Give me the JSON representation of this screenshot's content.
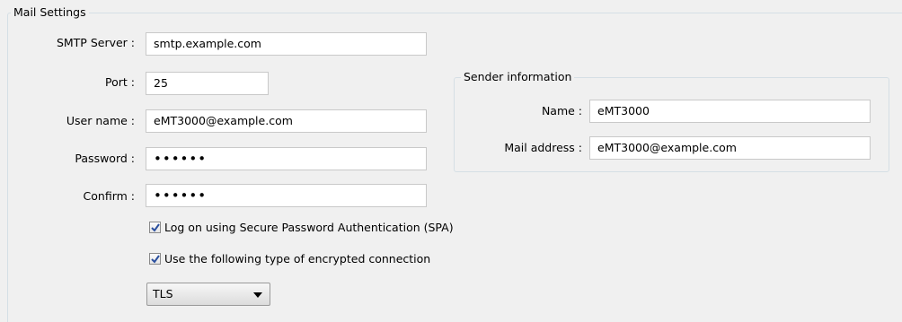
{
  "mail_settings": {
    "title": "Mail Settings",
    "smtp_server": {
      "label": "SMTP Server :",
      "value": "smtp.example.com"
    },
    "port": {
      "label": "Port :",
      "value": "25"
    },
    "user_name": {
      "label": "User name :",
      "value": "eMT3000@example.com"
    },
    "password": {
      "label": "Password :",
      "value": "••••••"
    },
    "confirm": {
      "label": "Confirm :",
      "value": "••••••"
    },
    "spa_checkbox": {
      "label": "Log on using Secure Password Authentication (SPA)",
      "checked": true
    },
    "encrypted_checkbox": {
      "label": "Use the following type of encrypted connection",
      "checked": true
    },
    "encryption_type": {
      "selected": "TLS",
      "icon": "chevron-down-icon"
    }
  },
  "sender_information": {
    "title": "Sender information",
    "name": {
      "label": "Name :",
      "value": "eMT3000"
    },
    "mail_address": {
      "label": "Mail address :",
      "value": "eMT3000@example.com"
    }
  },
  "colors": {
    "background": "#f0f0f0",
    "group_border": "#d5dfe5",
    "checkmark": "#2a4f9e"
  }
}
